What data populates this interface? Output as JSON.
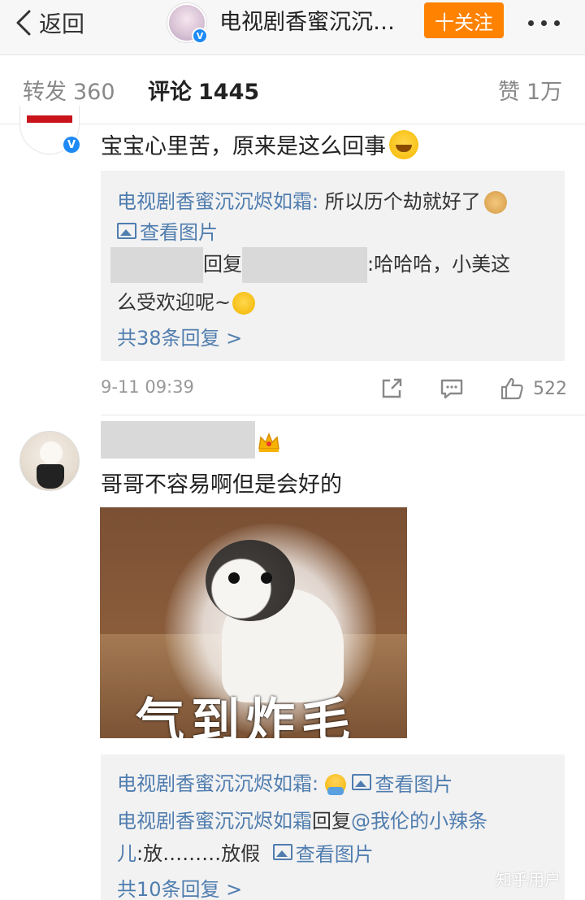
{
  "nav": {
    "back_label": "返回",
    "title": "电视剧香蜜沉沉…",
    "follow_label": "十关注"
  },
  "tabs": {
    "repost_label": "转发",
    "repost_count": "360",
    "comment_label": "评论",
    "comment_count": "1445",
    "like_label": "赞",
    "like_count": "1万"
  },
  "comments": [
    {
      "text": "宝宝心里苦，原来是这么回事",
      "replies": {
        "line1_author": "电视剧香蜜沉沉烬如霜:",
        "line1_text": " 所以历个劫就好了",
        "view_image": "查看图片",
        "reply_word": "回复",
        "line2_text": ":哈哈哈，小美这",
        "line2_cont": "么受欢迎呢~",
        "more": "共38条回复 >"
      },
      "time": "9-11 09:39",
      "likes": "522"
    },
    {
      "text": "哥哥不容易啊但是会好的",
      "image_caption": "气到炸毛",
      "replies": {
        "line1_author": "电视剧香蜜沉沉烬如霜:",
        "view_image": "查看图片",
        "line2_author": "电视剧香蜜沉沉烬如霜",
        "reply_word": "回复",
        "line2_mention": "@我伦的小辣条",
        "line2_mention_cont": "儿",
        "line2_text": ":放………放假",
        "more": "共10条回复 >"
      }
    }
  ],
  "watermark": "知乎用户",
  "colors": {
    "accent": "#ff8200",
    "link_blue": "#507daf",
    "verified_blue": "#1d8af5"
  }
}
